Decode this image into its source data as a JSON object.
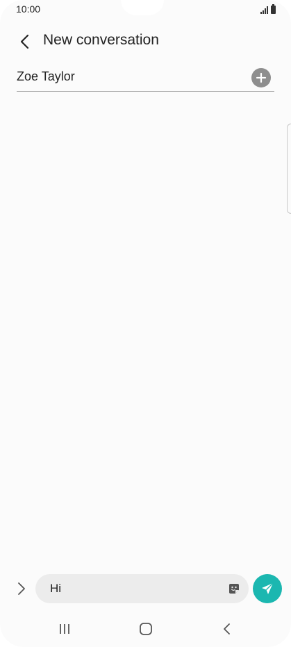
{
  "status_bar": {
    "time": "10:00",
    "icons": [
      "signal-icon",
      "battery-icon"
    ]
  },
  "header": {
    "title": "New conversation",
    "back_icon": "chevron-left-icon"
  },
  "recipient": {
    "name": "Zoe Taylor",
    "add_icon": "plus-circle-icon"
  },
  "composer": {
    "expand_icon": "chevron-right-icon",
    "message_value": "Hi",
    "sticker_icon": "sticker-icon",
    "send_icon": "send-icon",
    "send_color": "#1bb7b0"
  },
  "nav_bar": {
    "recents_icon": "recents-icon",
    "home_icon": "home-icon",
    "back_icon": "back-icon"
  }
}
